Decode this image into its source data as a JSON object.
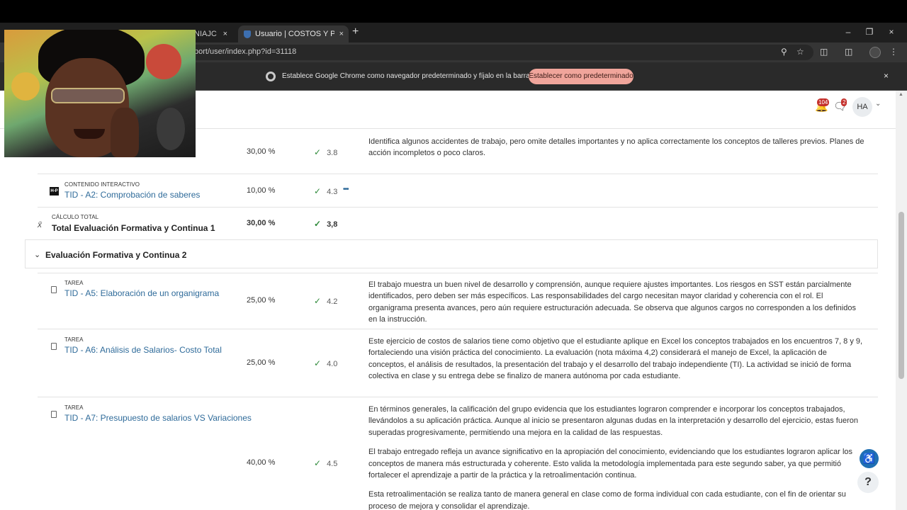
{
  "browser": {
    "tabs": [
      {
        "title": "NIAJC"
      },
      {
        "title": "Usuario | COSTOS Y PRESUPUESTO"
      }
    ],
    "url": "port/user/index.php?id=31118",
    "infobar": {
      "text": "Establece Google Chrome como navegador predeterminado y fíjalo en la barra de tareas",
      "button": "Establecer como predeterminado"
    }
  },
  "header": {
    "notifications_count": "104",
    "messages_count": "2",
    "avatar_initials": "HA"
  },
  "rows": [
    {
      "weight": "30,00 %",
      "grade": "3.8",
      "feedback": [
        "Identifica algunos accidentes de trabajo, pero omite detalles importantes y no aplica correctamente los conceptos de talleres previos. Planes de acción incompletos o poco claros."
      ]
    },
    {
      "type": "CONTENIDO INTERACTIVO",
      "name": "TID - A2: Comprobación de saberes",
      "weight": "10,00 %",
      "grade": "4.3"
    }
  ],
  "total_row": {
    "type": "CÁLCULO TOTAL",
    "name": "Total Evaluación Formativa y Continua 1",
    "weight": "30,00 %",
    "grade": "3,8"
  },
  "section": {
    "title": "Evaluación Formativa y Continua 2"
  },
  "items": [
    {
      "type": "TAREA",
      "name": "TID - A5: Elaboración de un organigrama",
      "weight": "25,00 %",
      "grade": "4.2",
      "feedback": [
        "El trabajo muestra un buen nivel de desarrollo y comprensión, aunque requiere ajustes importantes. Los riesgos en SST están parcialmente identificados, pero deben ser más específicos. Las responsabilidades del cargo necesitan mayor claridad y coherencia con el rol. El organigrama presenta avances, pero aún requiere estructuración adecuada. Se observa que algunos cargos no corresponden a los definidos en la instrucción."
      ]
    },
    {
      "type": "TAREA",
      "name": "TID - A6: Análisis de Salarios- Costo Total",
      "weight": "25,00 %",
      "grade": "4.0",
      "feedback": [
        "Este ejercicio de costos de salarios tiene como objetivo que el estudiante aplique en Excel los conceptos trabajados en los encuentros 7, 8 y 9, fortaleciendo una visión práctica del conocimiento. La evaluación (nota máxima 4,2) considerará el manejo de Excel, la aplicación de conceptos, el análisis de resultados, la presentación del trabajo y el desarrollo del trabajo independiente (TI). La actividad se inició de forma colectiva en clase y su entrega debe se  finalizo de manera autónoma por cada estudiante."
      ]
    },
    {
      "type": "TAREA",
      "name": "TID - A7: Presupuesto de salarios VS Variaciones",
      "weight": "40,00 %",
      "grade": "4.5",
      "feedback": [
        "En términos generales, la calificación del grupo evidencia que los estudiantes lograron comprender e incorporar los conceptos trabajados, llevándolos a su aplicación práctica. Aunque al inicio se presentaron algunas dudas en la interpretación y desarrollo del ejercicio, estas fueron superadas progresivamente, permitiendo una mejora en la calidad de las respuestas.",
        "El trabajo entregado refleja un avance significativo en la apropiación del conocimiento, evidenciando que los estudiantes lograron aplicar los conceptos de manera más estructurada y coherente. Esto valida la metodología implementada para este segundo saber, ya que permitió fortalecer el aprendizaje a partir de la práctica y la retroalimentación continua.",
        "Esta retroalimentación se realiza tanto de manera general en clase como de forma individual con cada estudiante, con el fin de orientar su proceso de mejora y consolidar el aprendizaje."
      ]
    }
  ],
  "icons": {
    "close": "×",
    "new_tab": "+",
    "check": "✓",
    "more": "•••",
    "chevron": "⌄",
    "sigma": "x̄",
    "help": "?"
  }
}
